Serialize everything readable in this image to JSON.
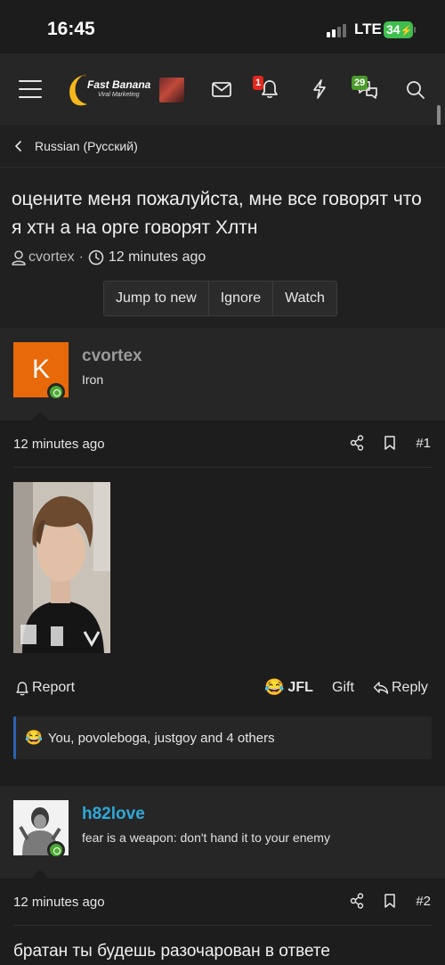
{
  "status_bar": {
    "time": "16:45",
    "network": "LTE",
    "battery": "34"
  },
  "nav": {
    "logo_text": "Fast Banana",
    "logo_sub": "Viral Marketing",
    "notifications_count": "1",
    "conversations_count": "29"
  },
  "breadcrumb": {
    "label": "Russian (Русский)"
  },
  "thread": {
    "title": "оцените меня пожалуйста, мне все говорят что я хтн а на орге говорят Хлтн",
    "author": "cvortex",
    "separator": "·",
    "time": "12 minutes ago",
    "buttons": {
      "jump": "Jump to new",
      "ignore": "Ignore",
      "watch": "Watch"
    }
  },
  "posts": [
    {
      "username": "cvortex",
      "user_title": "Iron",
      "avatar_letter": "K",
      "avatar_color": "#e8690a",
      "time": "12 minutes ago",
      "number": "#1",
      "actions": {
        "report": "Report",
        "reaction_label": "JFL",
        "gift": "Gift",
        "reply": "Reply"
      },
      "reactions_summary": "You, povoleboga, justgoy and 4 others"
    },
    {
      "username": "h82love",
      "user_title": "fear is a weapon: don't hand it to your enemy",
      "username_color": "#2fa8d8",
      "time": "12 minutes ago",
      "number": "#2",
      "body": "братан ты будешь разочарован в ответе"
    }
  ]
}
